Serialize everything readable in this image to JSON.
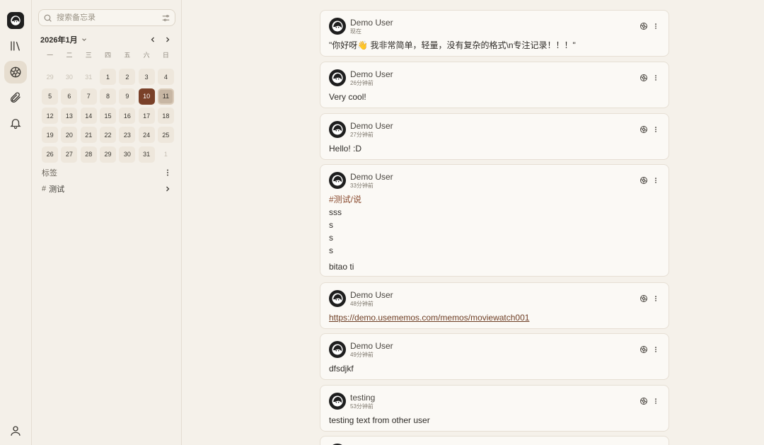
{
  "app": {
    "colors": {
      "accent": "#7a4129",
      "background": "#f5f1ea",
      "card": "#fbf9f5"
    }
  },
  "rail": {
    "items": [
      {
        "name": "logo",
        "icon": "app-logo-icon"
      },
      {
        "name": "explore",
        "icon": "library-icon"
      },
      {
        "name": "home",
        "icon": "compass-icon"
      },
      {
        "name": "attachments",
        "icon": "paperclip-icon"
      },
      {
        "name": "inbox",
        "icon": "bell-icon"
      },
      {
        "name": "profile",
        "icon": "user-icon"
      }
    ]
  },
  "sidebar": {
    "search": {
      "placeholder": "搜索备忘录",
      "value": ""
    },
    "calendar": {
      "title": "2026年1月",
      "weekdays": [
        "一",
        "二",
        "三",
        "四",
        "五",
        "六",
        "日"
      ],
      "days": [
        [
          "29",
          "30",
          "31",
          "1",
          "2",
          "3",
          "4"
        ],
        [
          "5",
          "6",
          "7",
          "8",
          "9",
          "10",
          "11"
        ],
        [
          "12",
          "13",
          "14",
          "15",
          "16",
          "17",
          "18"
        ],
        [
          "19",
          "20",
          "21",
          "22",
          "23",
          "24",
          "25"
        ],
        [
          "26",
          "27",
          "28",
          "29",
          "30",
          "31",
          "1"
        ]
      ]
    },
    "tags": {
      "title": "标签",
      "items": [
        {
          "hash": "#",
          "label": "测试"
        }
      ]
    }
  },
  "memos": [
    {
      "author": "Demo User",
      "time": "现在",
      "lines": [
        "\"你好呀👋 我非常简单，轻量，没有复杂的格式\\n专注记录！！！\""
      ]
    },
    {
      "author": "Demo User",
      "time": "26分钟前",
      "lines": [
        "Very cool!"
      ]
    },
    {
      "author": "Demo User",
      "time": "27分钟前",
      "lines": [
        "Hello! :D"
      ]
    },
    {
      "author": "Demo User",
      "time": "33分钟前",
      "tag": "#测试/说",
      "lines": [
        "sss",
        "s",
        "s",
        "s"
      ],
      "footer": "bitao ti"
    },
    {
      "author": "Demo User",
      "time": "48分钟前",
      "link": "https://demo.usememos.com/memos/moviewatch001"
    },
    {
      "author": "Demo User",
      "time": "49分钟前",
      "lines": [
        "dfsdjkf"
      ]
    },
    {
      "author": "testing",
      "time": "53分钟前",
      "lines": [
        "testing text from other user"
      ]
    }
  ]
}
